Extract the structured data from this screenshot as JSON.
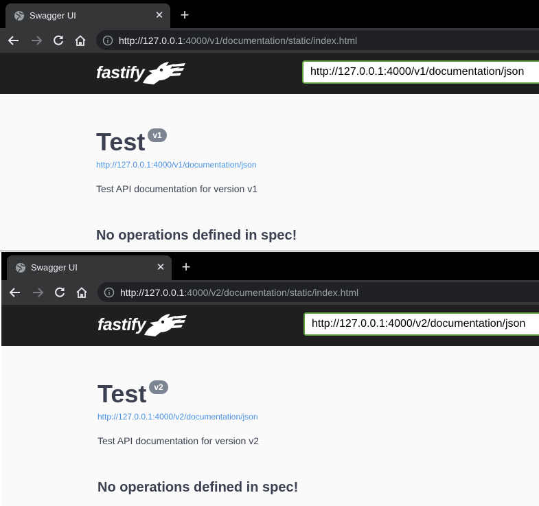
{
  "windows": [
    {
      "tab_title": "Swagger UI",
      "url_host": "http://127.0.0.1",
      "url_rest": ":4000/v1/documentation/static/index.html",
      "brand": "fastify",
      "spec_url_value": "http://127.0.0.1:4000/v1/documentation/json",
      "title": "Test",
      "version": "v1",
      "spec_link": "http://127.0.0.1:4000/v1/documentation/json",
      "description": "Test API documentation for version v1",
      "no_operations": "No operations defined in spec!"
    },
    {
      "tab_title": "Swagger UI",
      "url_host": "http://127.0.0.1",
      "url_rest": ":4000/v2/documentation/static/index.html",
      "brand": "fastify",
      "spec_url_value": "http://127.0.0.1:4000/v2/documentation/json",
      "title": "Test",
      "version": "v2",
      "spec_link": "http://127.0.0.1:4000/v2/documentation/json",
      "description": "Test API documentation for version v2",
      "no_operations": "No operations defined in spec!"
    }
  ],
  "icons": {
    "tab": "globe-icon",
    "close": "close-icon",
    "new_tab": "plus-icon",
    "back": "arrow-left-icon",
    "forward": "arrow-right-icon",
    "reload": "reload-icon",
    "home": "home-icon",
    "site_info": "info-icon",
    "logo": "fastify-logo-icon"
  },
  "colors": {
    "tabstrip": "#000000",
    "toolbar": "#353638",
    "topbar": "#1f1f1f",
    "input_border": "#62a03f",
    "link": "#4990e2",
    "text": "#3b4151",
    "badge": "#7d8492"
  }
}
